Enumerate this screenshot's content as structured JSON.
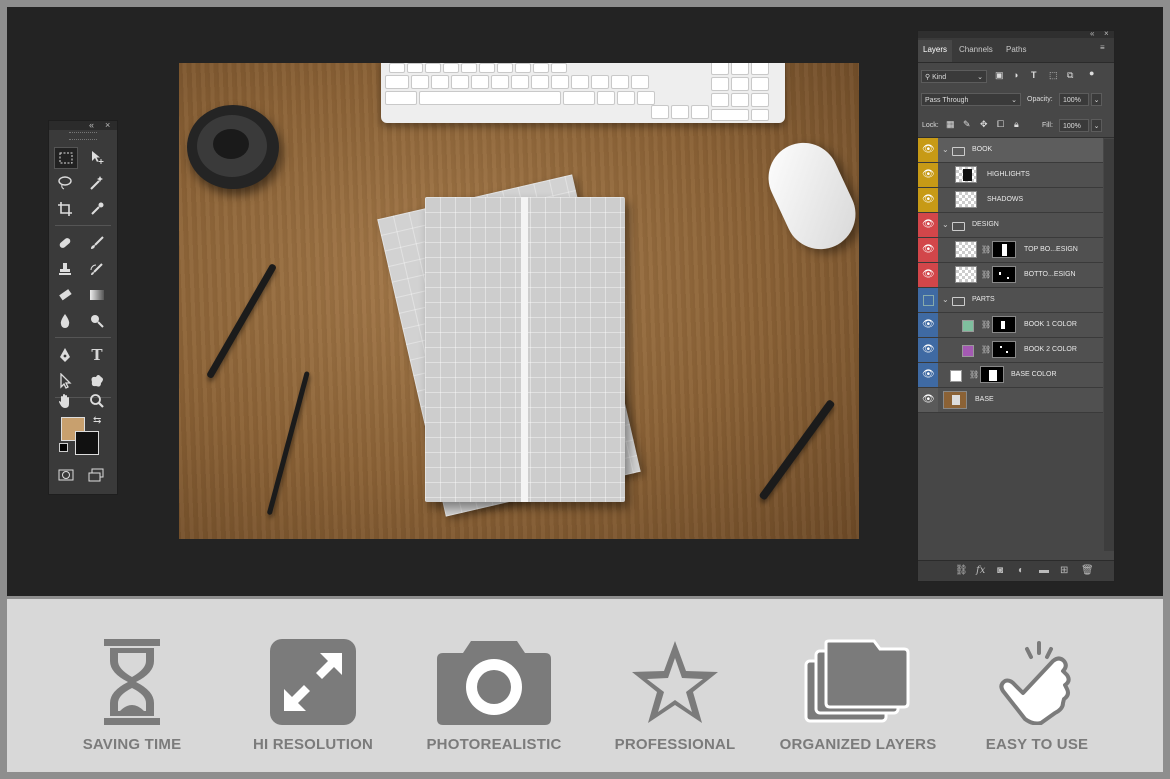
{
  "toolbar": {
    "collapse_glyph": "«",
    "close_glyph": "×",
    "tools": [
      {
        "name": "marquee-tool",
        "icon": "marquee-icon"
      },
      {
        "name": "move-tool",
        "icon": "move-icon"
      },
      {
        "name": "lasso-tool",
        "icon": "lasso-icon"
      },
      {
        "name": "magic-wand-tool",
        "icon": "magic-wand-icon"
      },
      {
        "name": "crop-tool",
        "icon": "crop-icon"
      },
      {
        "name": "eyedropper-tool",
        "icon": "eyedropper-icon"
      },
      {
        "name": "spot-healing-tool",
        "icon": "bandage-icon"
      },
      {
        "name": "brush-tool",
        "icon": "brush-icon"
      },
      {
        "name": "stamp-tool",
        "icon": "stamp-icon"
      },
      {
        "name": "history-brush-tool",
        "icon": "history-brush-icon"
      },
      {
        "name": "eraser-tool",
        "icon": "eraser-icon"
      },
      {
        "name": "gradient-tool",
        "icon": "gradient-icon"
      },
      {
        "name": "blur-tool",
        "icon": "drop-icon"
      },
      {
        "name": "dodge-tool",
        "icon": "dodge-icon"
      },
      {
        "name": "pen-tool",
        "icon": "pen-icon"
      },
      {
        "name": "type-tool",
        "icon": "type-icon",
        "glyph": "T"
      },
      {
        "name": "path-selection-tool",
        "icon": "arrow-icon"
      },
      {
        "name": "shape-tool",
        "icon": "shape-icon"
      },
      {
        "name": "hand-tool",
        "icon": "hand-icon"
      },
      {
        "name": "zoom-tool",
        "icon": "zoom-icon"
      }
    ],
    "foreground_color": "#c8a06e",
    "background_color": "#111111"
  },
  "layers_panel": {
    "tabs": [
      "Layers",
      "Channels",
      "Paths"
    ],
    "active_tab": "Layers",
    "filter_kind": "Kind",
    "blend_mode": "Pass Through",
    "opacity_label": "Opacity:",
    "opacity_value": "100%",
    "lock_label": "Lock:",
    "fill_label": "Fill:",
    "fill_value": "100%",
    "layers": [
      {
        "label": "BOOK",
        "type": "group",
        "tag_color": "#c79a16"
      },
      {
        "label": "HIGHLIGHTS",
        "type": "layer",
        "tag_color": "#c79a16"
      },
      {
        "label": "SHADOWS",
        "type": "layer",
        "tag_color": "#c79a16"
      },
      {
        "label": "DESIGN",
        "type": "group",
        "tag_color": "#d2464a"
      },
      {
        "label": "TOP BO...ESIGN",
        "type": "smart",
        "tag_color": "#d2464a"
      },
      {
        "label": "BOTTO...ESIGN",
        "type": "smart",
        "tag_color": "#d2464a"
      },
      {
        "label": "PARTS",
        "type": "group",
        "tag_color": "#3f6aa3"
      },
      {
        "label": "BOOK 1 COLOR",
        "type": "fill",
        "tag_color": "#3f6aa3",
        "swatch": "#7fbf9e"
      },
      {
        "label": "BOOK 2 COLOR",
        "type": "fill",
        "tag_color": "#3f6aa3",
        "swatch": "#a45ab3"
      },
      {
        "label": "BASE COLOR",
        "type": "fill",
        "tag_color": "#3f6aa3",
        "swatch": "#ffffff"
      },
      {
        "label": "BASE",
        "type": "photo",
        "tag_color": "#5a5a5a"
      }
    ]
  },
  "features": [
    {
      "label": "SAVING TIME",
      "icon": "hourglass-icon"
    },
    {
      "label": "HI RESOLUTION",
      "icon": "expand-icon"
    },
    {
      "label": "PHOTOREALISTIC",
      "icon": "camera-icon"
    },
    {
      "label": "PROFESSIONAL",
      "icon": "star-icon"
    },
    {
      "label": "ORGANIZED LAYERS",
      "icon": "folders-icon"
    },
    {
      "label": "EASY TO USE",
      "icon": "pointing-hand-icon"
    }
  ]
}
